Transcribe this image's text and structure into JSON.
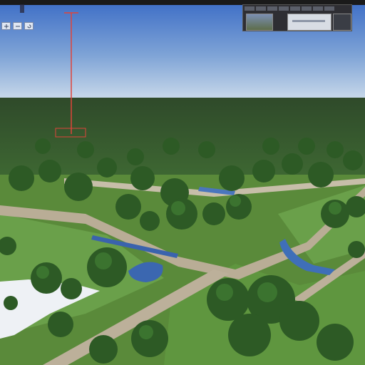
{
  "app": {
    "title": ""
  },
  "toolbar": {
    "menu_label": "",
    "controls": [
      {
        "name": "zoom-in-icon"
      },
      {
        "name": "zoom-out-icon"
      },
      {
        "name": "rotate-icon"
      }
    ]
  },
  "viewer_panel": {
    "tabs": [
      "tab-1",
      "tab-2",
      "tab-3",
      "tab-4",
      "tab-5",
      "tab-6",
      "tab-7",
      "tab-8"
    ]
  },
  "colors": {
    "sky_top": "#3e6fc4",
    "sky_horizon": "#c8d8ea",
    "grass": "#5a8a3a",
    "road": "#b7ab95",
    "water": "#3b67b0",
    "marker": "#e0443a"
  }
}
